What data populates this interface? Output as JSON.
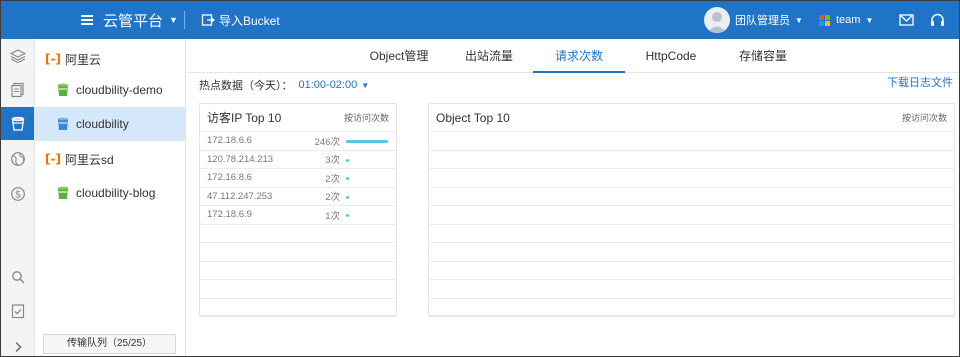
{
  "header": {
    "brand": "云管平台",
    "import_label": "导入Bucket",
    "user_name": "团队管理员",
    "team_name": "team"
  },
  "rail": {
    "icons": [
      "layers-icon",
      "documents-icon",
      "bucket-icon",
      "globe-icon",
      "dollar-icon",
      "search-icon",
      "task-check-icon",
      "expand-arrow-icon"
    ]
  },
  "sidebar": {
    "groups": [
      {
        "label": "阿里云",
        "items": [
          {
            "label": "cloudbility-demo",
            "active": false
          },
          {
            "label": "cloudbility",
            "active": true
          }
        ]
      },
      {
        "label": "阿里云sd",
        "items": [
          {
            "label": "cloudbility-blog",
            "active": false
          }
        ]
      }
    ],
    "queue_label": "传输队列（25/25）"
  },
  "tabs": [
    {
      "label": "Object管理",
      "active": false
    },
    {
      "label": "出站流量",
      "active": false
    },
    {
      "label": "请求次数",
      "active": true
    },
    {
      "label": "HttpCode",
      "active": false
    },
    {
      "label": "存储容量",
      "active": false
    }
  ],
  "hot": {
    "label": "热点数据（今天）：",
    "time": "01:00-02:00"
  },
  "download_label": "下载日志文件",
  "ip_panel": {
    "title": "访客IP Top 10",
    "note": "按访问次数",
    "rows": [
      {
        "ip": "172.18.6.6",
        "count": "246次",
        "share": 1.0
      },
      {
        "ip": "120.78.214.213",
        "count": "3次",
        "share": 0.012
      },
      {
        "ip": "172.16.8.6",
        "count": "2次",
        "share": 0.008
      },
      {
        "ip": "47.112.247.253",
        "count": "2次",
        "share": 0.008
      },
      {
        "ip": "172.18.6.9",
        "count": "1次",
        "share": 0.004
      }
    ]
  },
  "object_panel": {
    "title": "Object Top 10",
    "note": "按访问次数"
  },
  "colors": {
    "primary": "#1f74c7",
    "active_item_bg": "#d4e8fa",
    "bar": "#5bc3e6",
    "aliyun_orange": "#ff6a00"
  }
}
